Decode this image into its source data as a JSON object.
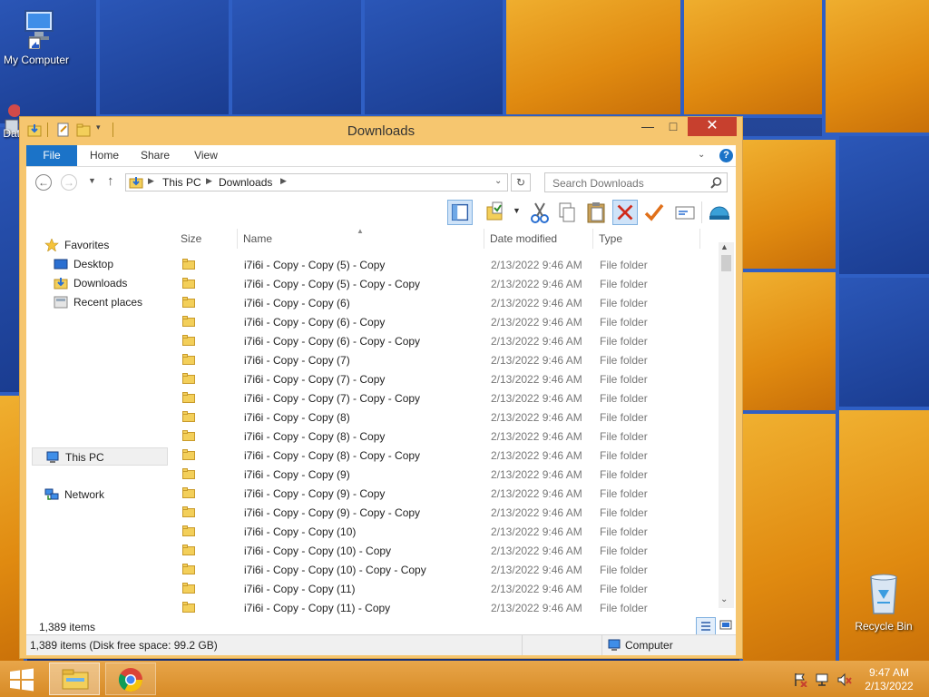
{
  "desktop": {
    "icons": [
      {
        "label": "My Computer"
      },
      {
        "label": "Dat"
      },
      {
        "label": "Recycle Bin"
      }
    ]
  },
  "window": {
    "title": "Downloads",
    "ribbon_tabs": [
      "File",
      "Home",
      "Share",
      "View"
    ],
    "breadcrumb": [
      "This PC",
      "Downloads"
    ],
    "search_placeholder": "Search Downloads",
    "nav": {
      "favorites": "Favorites",
      "desktop": "Desktop",
      "downloads": "Downloads",
      "recent": "Recent places",
      "this_pc": "This PC",
      "network": "Network"
    },
    "columns": {
      "size": "Size",
      "name": "Name",
      "date": "Date modified",
      "type": "Type"
    },
    "rows": [
      {
        "name": "i7i6i - Copy - Copy (5) - Copy",
        "date": "2/13/2022 9:46 AM",
        "type": "File folder"
      },
      {
        "name": "i7i6i - Copy - Copy (5) - Copy - Copy",
        "date": "2/13/2022 9:46 AM",
        "type": "File folder"
      },
      {
        "name": "i7i6i - Copy - Copy (6)",
        "date": "2/13/2022 9:46 AM",
        "type": "File folder"
      },
      {
        "name": "i7i6i - Copy - Copy (6) - Copy",
        "date": "2/13/2022 9:46 AM",
        "type": "File folder"
      },
      {
        "name": "i7i6i - Copy - Copy (6) - Copy - Copy",
        "date": "2/13/2022 9:46 AM",
        "type": "File folder"
      },
      {
        "name": "i7i6i - Copy - Copy (7)",
        "date": "2/13/2022 9:46 AM",
        "type": "File folder"
      },
      {
        "name": "i7i6i - Copy - Copy (7) - Copy",
        "date": "2/13/2022 9:46 AM",
        "type": "File folder"
      },
      {
        "name": "i7i6i - Copy - Copy (7) - Copy - Copy",
        "date": "2/13/2022 9:46 AM",
        "type": "File folder"
      },
      {
        "name": "i7i6i - Copy - Copy (8)",
        "date": "2/13/2022 9:46 AM",
        "type": "File folder"
      },
      {
        "name": "i7i6i - Copy - Copy (8) - Copy",
        "date": "2/13/2022 9:46 AM",
        "type": "File folder"
      },
      {
        "name": "i7i6i - Copy - Copy (8) - Copy - Copy",
        "date": "2/13/2022 9:46 AM",
        "type": "File folder"
      },
      {
        "name": "i7i6i - Copy - Copy (9)",
        "date": "2/13/2022 9:46 AM",
        "type": "File folder"
      },
      {
        "name": "i7i6i - Copy - Copy (9) - Copy",
        "date": "2/13/2022 9:46 AM",
        "type": "File folder"
      },
      {
        "name": "i7i6i - Copy - Copy (9) - Copy - Copy",
        "date": "2/13/2022 9:46 AM",
        "type": "File folder"
      },
      {
        "name": "i7i6i - Copy - Copy (10)",
        "date": "2/13/2022 9:46 AM",
        "type": "File folder"
      },
      {
        "name": "i7i6i - Copy - Copy (10) - Copy",
        "date": "2/13/2022 9:46 AM",
        "type": "File folder"
      },
      {
        "name": "i7i6i - Copy - Copy (10) - Copy - Copy",
        "date": "2/13/2022 9:46 AM",
        "type": "File folder"
      },
      {
        "name": "i7i6i - Copy - Copy (11)",
        "date": "2/13/2022 9:46 AM",
        "type": "File folder"
      },
      {
        "name": "i7i6i - Copy - Copy (11) - Copy",
        "date": "2/13/2022 9:46 AM",
        "type": "File folder"
      }
    ],
    "item_count": "1,389 items",
    "status_text": "1,389 items (Disk free space: 99.2 GB)",
    "status_location": "Computer"
  },
  "taskbar": {
    "time": "9:47 AM",
    "date": "2/13/2022"
  },
  "colors": {
    "window_frame": "#f6c66f",
    "close_button": "#c7402e",
    "file_tab": "#1b73c8",
    "taskbar": "#e09a38"
  }
}
